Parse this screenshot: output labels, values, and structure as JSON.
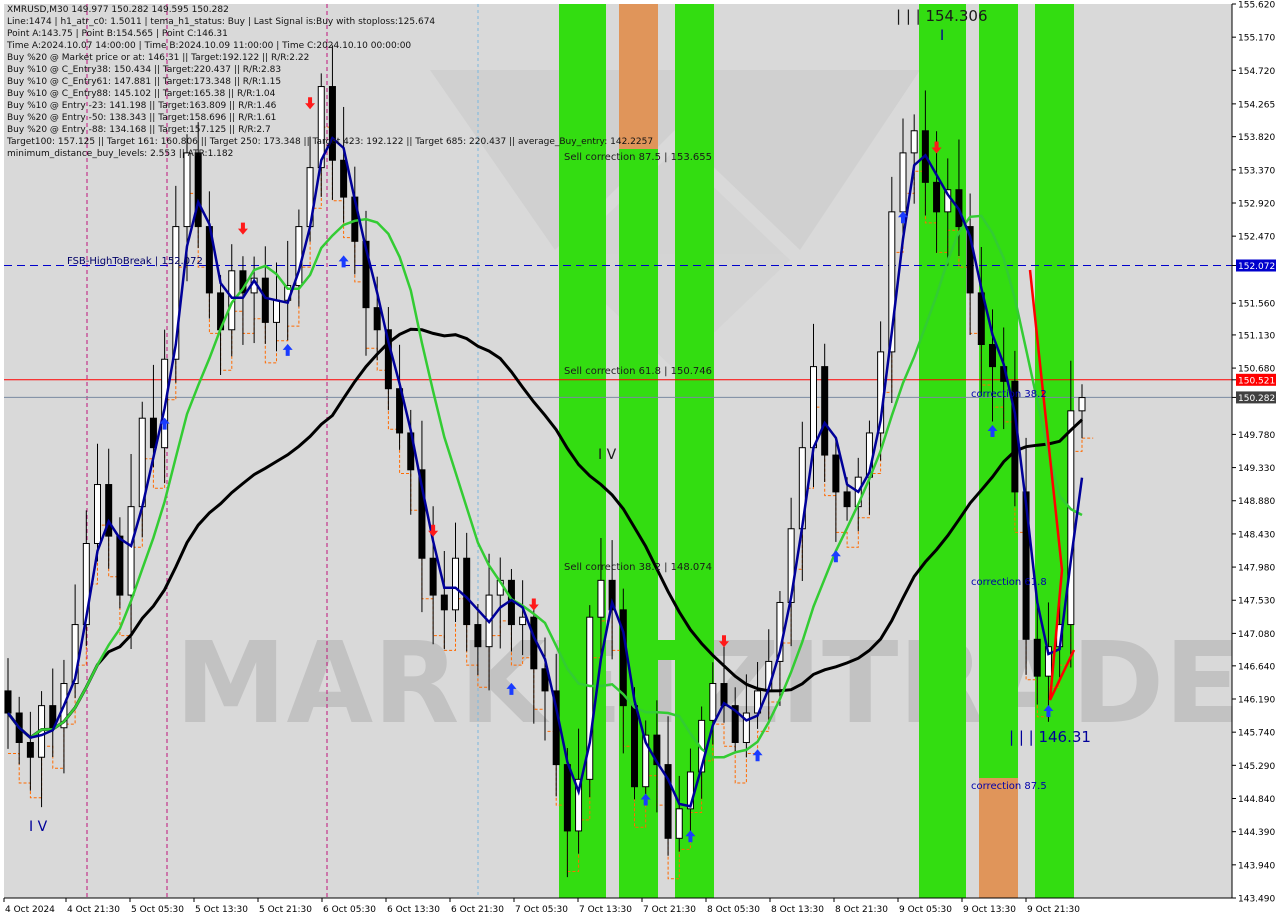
{
  "info": {
    "lines": [
      "XMRUSD,M30  149.977 150.282 149.595 150.282",
      "Line:1474 | h1_atr_c0: 1.5011 | tema_h1_status: Buy | Last Signal is:Buy with stoploss:125.674",
      "Point A:143.75 | Point B:154.565 | Point C:146.31",
      "Time A:2024.10.07 14:00:00 | Time B:2024.10.09 11:00:00 | Time C:2024.10.10 00:00:00",
      "Buy %20 @ Market price or at: 146.31 || Target:192.122 || R/R:2.22",
      "Buy %10 @ C_Entry38: 150.434 || Target:220.437 || R/R:2.83",
      "Buy %10 @ C_Entry61: 147.881 || Target:173.348 || R/R:1.15",
      "Buy %10 @ C_Entry88: 145.102 || Target:165.38 || R/R:1.04",
      "Buy %10 @ Entry -23: 141.198 || Target:163.809 || R/R:1.46",
      "Buy %20 @ Entry -50: 138.343 || Target:158.696 || R/R:1.61",
      "Buy %20 @ Entry -88: 134.168 || Target:157.125 || R/R:2.7",
      "Target100: 157.125 || Target 161: 160.806 || Target 250: 173.348 || Target 423: 192.122 || Target 685: 220.437 || average_Buy_entry: 142.2257",
      "minimum_distance_buy_levels: 2.553 || ATR:1.182"
    ]
  },
  "labels": {
    "fsb": "FSB-HighToBreak | 152.072",
    "sell875": "Sell correction 87.5 | 153.655",
    "sell618": "Sell correction 61.8 | 150.746",
    "sell382": "Sell correction 38.2 | 148.074",
    "corr382": "correction 38.2",
    "corr618": "correction 61.8",
    "corr875": "correction 87.5",
    "pointB": "| | | 154.306",
    "pointC": "| | | 146.31",
    "wave4a": "I V",
    "wave4b": "I V",
    "waveTop": "I",
    "watermark": "MARKETZITRADE"
  },
  "colors": {
    "green_band": "#33dd11",
    "orange_band": "#e0955a",
    "tema": "#000099",
    "ma_green": "#33cc33",
    "ma_black": "#000000",
    "red_line": "#ff0000",
    "blue_dash": "#0000cc",
    "price_tag": "#404040"
  },
  "chart_data": {
    "type": "candlestick",
    "symbol": "XMRUSD",
    "timeframe": "M30",
    "ylim": [
      143.49,
      155.62
    ],
    "y_ticks": [
      "155.620",
      "155.170",
      "154.720",
      "154.265",
      "153.820",
      "153.370",
      "152.920",
      "152.470",
      "152.072",
      "151.560",
      "151.130",
      "150.680",
      "150.521",
      "150.282",
      "149.780",
      "149.330",
      "148.880",
      "148.430",
      "147.980",
      "147.530",
      "147.080",
      "146.640",
      "146.190",
      "145.740",
      "145.290",
      "144.840",
      "144.390",
      "143.940",
      "143.490"
    ],
    "x_ticks": [
      "4 Oct 2024",
      "4 Oct 21:30",
      "5 Oct 05:30",
      "5 Oct 13:30",
      "5 Oct 21:30",
      "6 Oct 05:30",
      "6 Oct 13:30",
      "6 Oct 21:30",
      "7 Oct 05:30",
      "7 Oct 13:30",
      "7 Oct 21:30",
      "8 Oct 05:30",
      "8 Oct 13:30",
      "8 Oct 21:30",
      "9 Oct 05:30",
      "9 Oct 13:30",
      "9 Oct 21:30"
    ],
    "levels": {
      "fsb_high_to_break": 152.072,
      "red_level": 150.521,
      "current_price": 150.282
    },
    "highlighted_ticks": [
      {
        "value": "152.072",
        "color": "#0000cc"
      },
      {
        "value": "150.521",
        "color": "#ff0000"
      },
      {
        "value": "150.282",
        "color": "#404040"
      }
    ],
    "close_series": [
      146.0,
      145.6,
      145.4,
      146.1,
      145.8,
      146.4,
      147.2,
      148.3,
      149.1,
      148.4,
      147.6,
      148.8,
      150.0,
      149.6,
      150.8,
      152.6,
      153.6,
      152.6,
      151.7,
      151.2,
      152.0,
      151.7,
      151.9,
      151.3,
      151.6,
      151.8,
      152.6,
      153.4,
      154.5,
      153.5,
      153.0,
      152.4,
      151.5,
      151.2,
      150.4,
      149.8,
      149.3,
      148.1,
      147.6,
      147.4,
      148.1,
      147.2,
      146.9,
      147.6,
      147.8,
      147.2,
      147.3,
      146.6,
      146.3,
      145.3,
      144.4,
      145.1,
      147.3,
      147.8,
      147.4,
      146.1,
      145.0,
      145.7,
      145.3,
      144.3,
      144.7,
      145.2,
      145.9,
      146.4,
      146.1,
      145.6,
      146.0,
      146.3,
      146.7,
      147.5,
      148.5,
      149.6,
      150.7,
      149.5,
      149.0,
      148.8,
      149.2,
      149.8,
      150.9,
      152.8,
      153.6,
      153.9,
      153.2,
      152.8,
      153.1,
      152.6,
      151.7,
      151.0,
      150.7,
      150.5,
      149.0,
      147.0,
      146.5,
      146.9,
      147.2,
      150.1,
      150.28
    ]
  }
}
